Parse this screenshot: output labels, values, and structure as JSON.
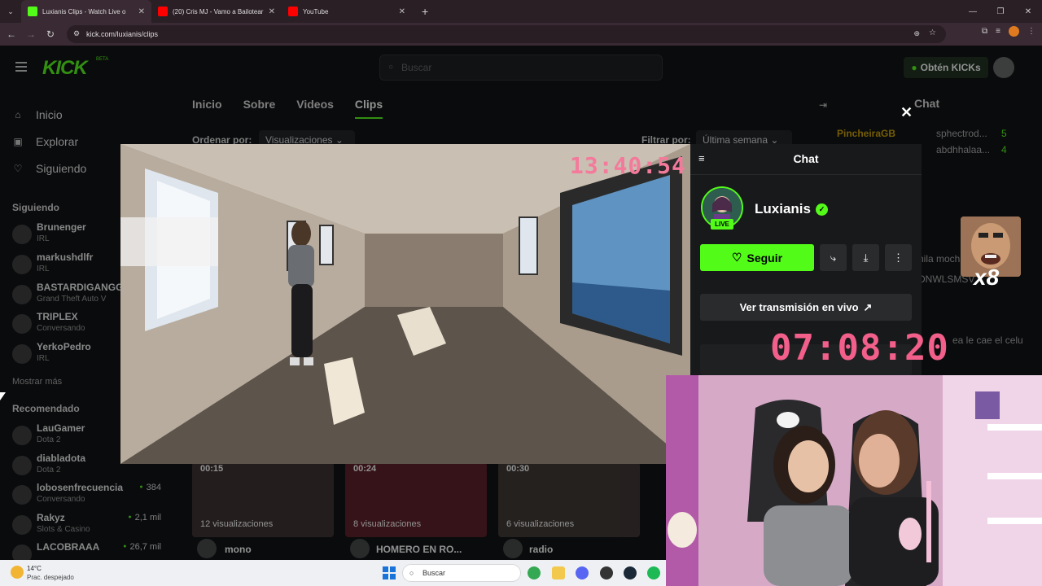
{
  "browser": {
    "tabs": [
      {
        "title": "Luxianis Clips - Watch Live o",
        "active": true,
        "favicon_color": "#53fc18"
      },
      {
        "title": "(20) Cris MJ - Vamo a Bailotear",
        "active": false,
        "favicon_color": "#ff0000"
      },
      {
        "title": "YouTube",
        "active": false,
        "favicon_color": "#ff0000"
      }
    ],
    "url": "kick.com/luxianis/clips"
  },
  "header": {
    "logo": "KICK",
    "beta": "BETA",
    "search_placeholder": "Buscar",
    "get_kicks_label": "Obtén KICKs"
  },
  "sidebar": {
    "nav": [
      {
        "label": "Inicio",
        "icon": "home-icon"
      },
      {
        "label": "Explorar",
        "icon": "compass-icon"
      },
      {
        "label": "Siguiendo",
        "icon": "heart-icon"
      }
    ],
    "following_title": "Siguiendo",
    "following": [
      {
        "name": "Brunenger",
        "sub": "IRL"
      },
      {
        "name": "markushdlfr",
        "sub": "IRL"
      },
      {
        "name": "BASTARDIGANGG",
        "sub": "Grand Theft Auto V"
      },
      {
        "name": "TRIPLEX",
        "sub": "Conversando"
      },
      {
        "name": "YerkoPedro",
        "sub": "IRL"
      }
    ],
    "show_more": "Mostrar más",
    "recommended_title": "Recomendado",
    "recommended": [
      {
        "name": "LauGamer",
        "sub": "Dota 2",
        "viewers": ""
      },
      {
        "name": "diabladota",
        "sub": "Dota 2",
        "viewers": ""
      },
      {
        "name": "lobosenfrecuencia",
        "sub": "Conversando",
        "viewers": "384"
      },
      {
        "name": "Rakyz",
        "sub": "Slots & Casino",
        "viewers": "2,1 mil"
      },
      {
        "name": "LACOBRAAA",
        "sub": "",
        "viewers": "26,7 mil"
      }
    ]
  },
  "profile_tabs": [
    "Inicio",
    "Sobre",
    "Videos",
    "Clips"
  ],
  "active_tab": "Clips",
  "filters": {
    "order_label": "Ordenar por:",
    "order_value": "Visualizaciones",
    "filter_label": "Filtrar por:",
    "filter_value": "Última semana"
  },
  "page_chat": {
    "title": "Chat",
    "lines": [
      "PincheiraGB",
      "sphectrod...",
      "5",
      "abdhhalaa...",
      "4",
      "hila moch",
      "DNWLSMSV",
      "ea le cae el celu"
    ]
  },
  "clips": [
    {
      "duration": "00:15",
      "views": "12 visualizaciones",
      "title": "mono"
    },
    {
      "duration": "00:24",
      "views": "8 visualizaciones",
      "title": "HOMERO EN RO..."
    },
    {
      "duration": "00:30",
      "views": "6 visualizaciones",
      "title": "radio"
    }
  ],
  "video_overlay": {
    "clock": "13:40:54"
  },
  "chat_panel": {
    "title": "Chat",
    "channel": "Luxianis",
    "live_badge": "LIVE",
    "follow_label": "Seguir",
    "watch_live_label": "Ver transmisión en vivo"
  },
  "stream_clock": "07:08:20",
  "meme_badge": "x8",
  "taskbar": {
    "temp": "14°C",
    "weather": "Prac. despejado",
    "search": "Buscar"
  }
}
